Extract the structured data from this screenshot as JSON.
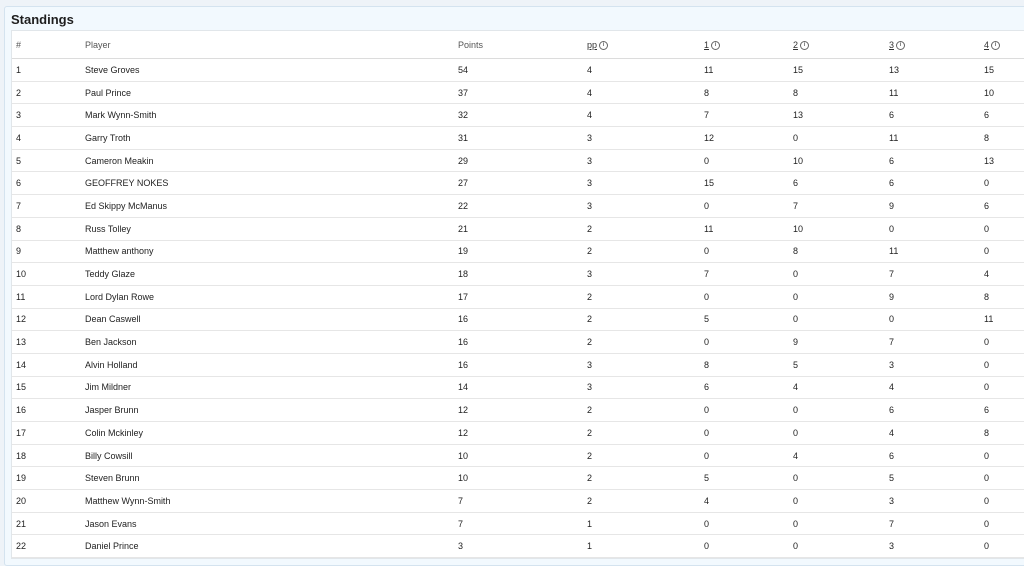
{
  "panel": {
    "title": "Standings"
  },
  "table": {
    "headers": {
      "rank": "#",
      "player": "Player",
      "points": "Points",
      "pp": "pp",
      "r1": "1",
      "r2": "2",
      "r3": "3",
      "r4": "4"
    },
    "info_icon_glyph": "i",
    "rows": [
      {
        "rank": "1",
        "player": "Steve Groves",
        "points": "54",
        "pp": "4",
        "r1": "11",
        "r2": "15",
        "r3": "13",
        "r4": "15"
      },
      {
        "rank": "2",
        "player": "Paul Prince",
        "points": "37",
        "pp": "4",
        "r1": "8",
        "r2": "8",
        "r3": "11",
        "r4": "10"
      },
      {
        "rank": "3",
        "player": "Mark Wynn-Smith",
        "points": "32",
        "pp": "4",
        "r1": "7",
        "r2": "13",
        "r3": "6",
        "r4": "6"
      },
      {
        "rank": "4",
        "player": "Garry Troth",
        "points": "31",
        "pp": "3",
        "r1": "12",
        "r2": "0",
        "r3": "11",
        "r4": "8"
      },
      {
        "rank": "5",
        "player": "Cameron Meakin",
        "points": "29",
        "pp": "3",
        "r1": "0",
        "r2": "10",
        "r3": "6",
        "r4": "13"
      },
      {
        "rank": "6",
        "player": "GEOFFREY NOKES",
        "points": "27",
        "pp": "3",
        "r1": "15",
        "r2": "6",
        "r3": "6",
        "r4": "0"
      },
      {
        "rank": "7",
        "player": "Ed Skippy McManus",
        "points": "22",
        "pp": "3",
        "r1": "0",
        "r2": "7",
        "r3": "9",
        "r4": "6"
      },
      {
        "rank": "8",
        "player": "Russ Tolley",
        "points": "21",
        "pp": "2",
        "r1": "11",
        "r2": "10",
        "r3": "0",
        "r4": "0"
      },
      {
        "rank": "9",
        "player": "Matthew anthony",
        "points": "19",
        "pp": "2",
        "r1": "0",
        "r2": "8",
        "r3": "11",
        "r4": "0"
      },
      {
        "rank": "10",
        "player": "Teddy Glaze",
        "points": "18",
        "pp": "3",
        "r1": "7",
        "r2": "0",
        "r3": "7",
        "r4": "4"
      },
      {
        "rank": "11",
        "player": "Lord Dylan Rowe",
        "points": "17",
        "pp": "2",
        "r1": "0",
        "r2": "0",
        "r3": "9",
        "r4": "8"
      },
      {
        "rank": "12",
        "player": "Dean Caswell",
        "points": "16",
        "pp": "2",
        "r1": "5",
        "r2": "0",
        "r3": "0",
        "r4": "11"
      },
      {
        "rank": "13",
        "player": "Ben Jackson",
        "points": "16",
        "pp": "2",
        "r1": "0",
        "r2": "9",
        "r3": "7",
        "r4": "0"
      },
      {
        "rank": "14",
        "player": "Alvin Holland",
        "points": "16",
        "pp": "3",
        "r1": "8",
        "r2": "5",
        "r3": "3",
        "r4": "0"
      },
      {
        "rank": "15",
        "player": "Jim Mildner",
        "points": "14",
        "pp": "3",
        "r1": "6",
        "r2": "4",
        "r3": "4",
        "r4": "0"
      },
      {
        "rank": "16",
        "player": "Jasper Brunn",
        "points": "12",
        "pp": "2",
        "r1": "0",
        "r2": "0",
        "r3": "6",
        "r4": "6"
      },
      {
        "rank": "17",
        "player": "Colin Mckinley",
        "points": "12",
        "pp": "2",
        "r1": "0",
        "r2": "0",
        "r3": "4",
        "r4": "8"
      },
      {
        "rank": "18",
        "player": "Billy Cowsill",
        "points": "10",
        "pp": "2",
        "r1": "0",
        "r2": "4",
        "r3": "6",
        "r4": "0"
      },
      {
        "rank": "19",
        "player": "Steven Brunn",
        "points": "10",
        "pp": "2",
        "r1": "5",
        "r2": "0",
        "r3": "5",
        "r4": "0"
      },
      {
        "rank": "20",
        "player": "Matthew Wynn-Smith",
        "points": "7",
        "pp": "2",
        "r1": "4",
        "r2": "0",
        "r3": "3",
        "r4": "0"
      },
      {
        "rank": "21",
        "player": "Jason Evans",
        "points": "7",
        "pp": "1",
        "r1": "0",
        "r2": "0",
        "r3": "7",
        "r4": "0"
      },
      {
        "rank": "22",
        "player": "Daniel Prince",
        "points": "3",
        "pp": "1",
        "r1": "0",
        "r2": "0",
        "r3": "3",
        "r4": "0"
      }
    ]
  }
}
